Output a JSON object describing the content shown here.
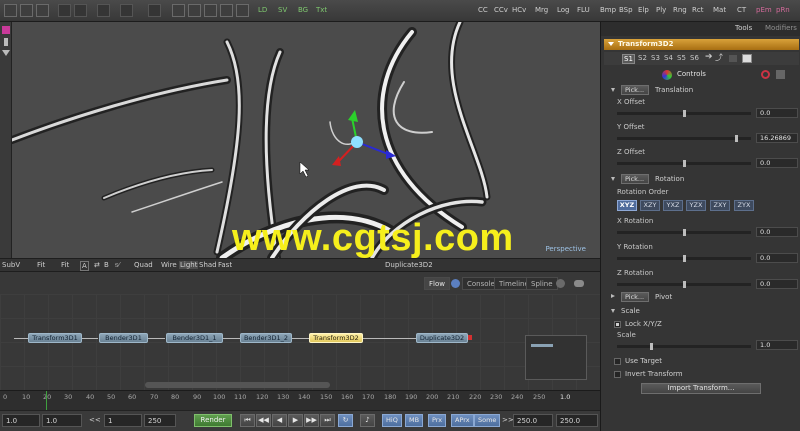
{
  "toolbar": {
    "view_modes": [
      "LD",
      "SV",
      "BG",
      "Txt"
    ],
    "tools": [
      "CC",
      "CCv",
      "HCv",
      "Mrg",
      "Log",
      "FLU",
      "Bmp",
      "BSp",
      "Elp",
      "Ply",
      "Rng",
      "Rct",
      "Mat",
      "CT",
      "pEm",
      "pRn"
    ],
    "colors": {
      "green": "#7fc86f",
      "pink": "#d26a9a"
    }
  },
  "viewport": {
    "label": "Perspective",
    "watermark": "www.cgtsj.com",
    "gizmo": {
      "x_color": "#d42020",
      "y_color": "#2bd12b",
      "z_color": "#2a2ad4"
    }
  },
  "viewer_bar": {
    "subview": "SubV",
    "fit1": "Fit",
    "fit2": "Fit",
    "opts": [
      "A",
      "B"
    ],
    "quad": "Quad",
    "shading": [
      "Wire",
      "Light",
      "Shad",
      "Fast"
    ],
    "node_name": "Duplicate3D2"
  },
  "flow": {
    "tabs": [
      "Flow",
      "Console",
      "Timeline",
      "Spline"
    ],
    "nodes": [
      "Transform3D1",
      "Bender3D1",
      "Bender3D1_1",
      "Bender3D1_2",
      "Transform3D2",
      "Duplicate3D2"
    ],
    "selected_node": "Transform3D2"
  },
  "timeline": {
    "ticks": [
      "0",
      "10",
      "20",
      "30",
      "40",
      "50",
      "60",
      "70",
      "80",
      "90",
      "100",
      "110",
      "120",
      "130",
      "140",
      "150",
      "160",
      "170",
      "180",
      "190",
      "200",
      "210",
      "220",
      "230",
      "240",
      "250"
    ],
    "current": "1.0"
  },
  "transport": {
    "start": "1.0",
    "render_start": "1.0",
    "prev": "<<",
    "range_start": "1",
    "range_end": "250",
    "render": "Render",
    "hiq": "HiQ",
    "mb": "MB",
    "prx": "Prx",
    "aprx": "APrx",
    "some": "Some",
    "next": ">>",
    "render_end": "250.0",
    "end": "250.0"
  },
  "panel": {
    "tabs": [
      "Tools",
      "Modifiers"
    ],
    "tool_name": "Transform3D2",
    "subtabs": [
      "S1",
      "S2",
      "S3",
      "S4",
      "S5",
      "S6"
    ],
    "controls_label": "Controls",
    "pick": "Pick...",
    "translation": {
      "name": "Translation",
      "x_label": "X Offset",
      "x_value": "0.0",
      "x_pos": 0.5,
      "y_label": "Y Offset",
      "y_value": "16.26869",
      "y_pos": 0.9,
      "z_label": "Z Offset",
      "z_value": "0.0",
      "z_pos": 0.5
    },
    "rotation": {
      "name": "Rotation",
      "order_label": "Rotation Order",
      "orders": [
        "XYZ",
        "XZY",
        "YXZ",
        "YZX",
        "ZXY",
        "ZYX"
      ],
      "active_order": "XYZ",
      "x_label": "X Rotation",
      "x_value": "0.0",
      "x_pos": 0.5,
      "y_label": "Y Rotation",
      "y_value": "0.0",
      "y_pos": 0.5,
      "z_label": "Z Rotation",
      "z_value": "0.0",
      "z_pos": 0.5
    },
    "pivot": {
      "name": "Pivot"
    },
    "scale": {
      "name": "Scale",
      "lock_label": "Lock X/Y/Z",
      "scale_label": "Scale",
      "scale_value": "1.0",
      "scale_pos": 0.25
    },
    "use_target": "Use Target",
    "invert_transform": "Invert Transform",
    "import_button": "Import Transform..."
  }
}
